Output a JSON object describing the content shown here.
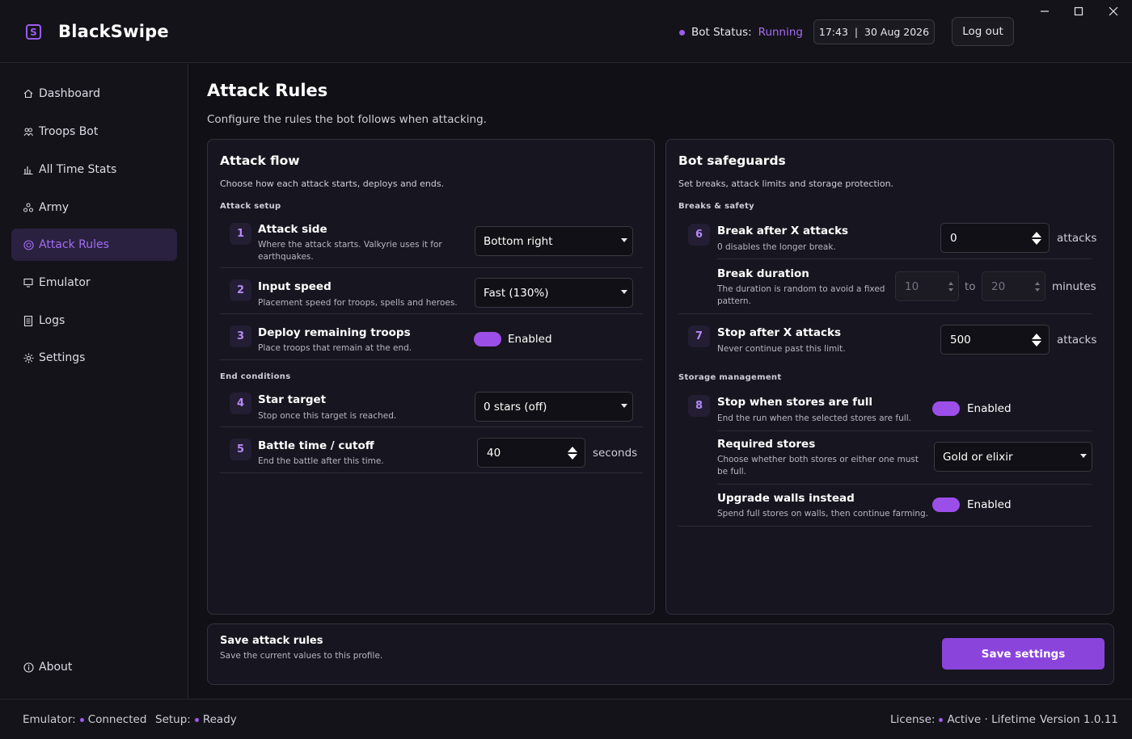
{
  "app": {
    "logo_letter": "S",
    "title": "BlackSwipe"
  },
  "header": {
    "bot_status_label": "Bot Status:",
    "bot_status_value": "Running",
    "clock": "17:43  |  30 Aug 2026",
    "logout_label": "Log out",
    "accent_color": "#9b5cf0"
  },
  "sidebar": {
    "items": [
      {
        "label": "Dashboard",
        "icon": "home-icon"
      },
      {
        "label": "Troops Bot",
        "icon": "users-icon"
      },
      {
        "label": "All Time Stats",
        "icon": "bar-chart-icon"
      },
      {
        "label": "Army",
        "icon": "army-icon"
      },
      {
        "label": "Attack Rules",
        "icon": "target-icon",
        "active": true
      },
      {
        "label": "Emulator",
        "icon": "monitor-icon"
      },
      {
        "label": "Logs",
        "icon": "document-icon"
      },
      {
        "label": "Settings",
        "icon": "gear-icon"
      }
    ],
    "about_label": "About"
  },
  "page": {
    "title": "Attack Rules",
    "subtitle": "Configure the rules the bot follows when attacking."
  },
  "attack_flow": {
    "title": "Attack flow",
    "subtitle": "Choose how each attack starts, deploys and ends.",
    "section_setup": "Attack setup",
    "section_end": "End conditions",
    "rows": [
      {
        "num": "1",
        "title": "Attack side",
        "desc": "Where the attack starts. Valkyrie uses it for earthquakes.",
        "value": "Bottom right"
      },
      {
        "num": "2",
        "title": "Input speed",
        "desc": "Placement speed for troops, spells and heroes.",
        "value": "Fast (130%)"
      },
      {
        "num": "3",
        "title": "Deploy remaining troops",
        "desc": "Place troops that remain at the end.",
        "value": "Enabled"
      },
      {
        "num": "4",
        "title": "Star target",
        "desc": "Stop once this target is reached.",
        "value": "0 stars (off)"
      },
      {
        "num": "5",
        "title": "Battle time / cutoff",
        "desc": "End the battle after this time.",
        "value": "40",
        "unit": "seconds"
      }
    ]
  },
  "safeguards": {
    "title": "Bot safeguards",
    "subtitle": "Set breaks, attack limits and storage protection.",
    "section_breaks": "Breaks & safety",
    "section_storage": "Storage management",
    "break_after": {
      "num": "6",
      "title": "Break after X attacks",
      "desc": "0 disables the longer break.",
      "value": "0",
      "unit": "attacks"
    },
    "break_duration": {
      "title": "Break duration",
      "desc": "The duration is random to avoid a fixed pattern.",
      "min": "10",
      "to_label": "to",
      "max": "20",
      "unit": "minutes"
    },
    "stop_after": {
      "num": "7",
      "title": "Stop after X attacks",
      "desc": "Never continue past this limit.",
      "value": "500",
      "unit": "attacks"
    },
    "stop_full": {
      "num": "8",
      "title": "Stop when stores are full",
      "desc": "End the run when the selected stores are full.",
      "value": "Enabled"
    },
    "required_stores": {
      "title": "Required stores",
      "desc": "Choose whether both stores or either one must be full.",
      "value": "Gold or elixir"
    },
    "upgrade_walls": {
      "title": "Upgrade walls instead",
      "desc": "Spend full stores on walls, then continue farming.",
      "value": "Enabled"
    }
  },
  "save_bar": {
    "title": "Save attack rules",
    "subtitle": "Save the current values to this profile.",
    "button_label": "Save settings"
  },
  "footer": {
    "emulator_label": "Emulator:",
    "emulator_value": "Connected",
    "setup_label": "Setup:",
    "setup_value": "Ready",
    "license_label": "License:",
    "license_value": "Active · Lifetime",
    "version": "Version 1.0.11"
  }
}
